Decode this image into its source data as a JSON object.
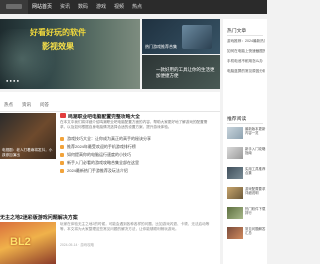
{
  "nav": {
    "items": [
      "网站首页",
      "资讯",
      "数码",
      "游戏",
      "视频",
      "热点"
    ],
    "active_index": 0
  },
  "banner": {
    "main_title_1": "好看好玩的软件",
    "main_title_2": "影视效果",
    "main_dots": "● ● ● ●",
    "side1_label": "热门游戏推荐合集",
    "side2_label": "一款好用的工具让你的生活更加便捷方便"
  },
  "tabs": [
    "热点",
    "资讯",
    "问答"
  ],
  "featured": {
    "video_caption": "电视剧：老人打着麻将发抖，小孩参加演出",
    "title": "鸣潮职业吧电脑配置完整攻略大全",
    "excerpt": "在本文中我们将详细介绍鸣潮职业吧电脑配置方面的内容，帮助大家更好地了解游戏的配置需求，以及如何根据自身电脑情况选择合适的设置方案，提升游戏体验。"
  },
  "list": [
    "游戏技巧大全：让你成为真正的高手的秘诀分享",
    "推荐2024年最受欢迎的手机游戏排行榜",
    "如何提高你的电脑运行速度的小技巧",
    "新手入门必看的游戏攻略合集全部在这里",
    "2024最新热门手游推荐及玩法介绍"
  ],
  "section2": {
    "title": "无主之地2迷彩版游戏问题解决方案",
    "excerpt": "玩家在体验无主之地2的时候，可能会遇到各种各样的问题，比如游戏闪退、卡顿、无法启动等等，本文将为大家整理这些常见问题的解决方法，让你能够顺利畅玩游戏。",
    "meta": "2024-05-14 · 游戏攻略",
    "thumb_text": "BL2"
  },
  "sidebar": {
    "hot_title": "热门文章",
    "hot_items": [
      "游戏推荐：2024最新热门游戏",
      "如何在电脑上快速截图的方法",
      "手机电池不耐用怎么办",
      "电脑蓝屏的常见原因分析"
    ],
    "rec_title": "推荐阅读",
    "rec_items": [
      "最新版本更新内容一览",
      "新手入门攻略指南",
      "实用工具推荐合集",
      "游戏配置要求详细说明",
      "热门软件下载排行",
      "常见问题解答汇总"
    ]
  },
  "colors": {
    "nav_bg": "#2b2b2b",
    "accent_hot": "#e23d3d",
    "bullet": "#f2a33a"
  }
}
